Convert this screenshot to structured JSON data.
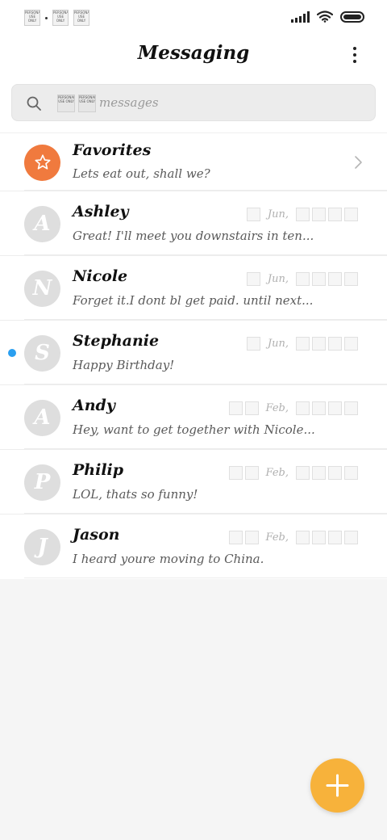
{
  "header": {
    "title": "Messaging"
  },
  "search": {
    "placeholder": "messages",
    "search_icon": "search-icon"
  },
  "status": {
    "watermark": "PERSONAL USE ONLY"
  },
  "conversations": [
    {
      "name": "Favorites",
      "snippet": "Lets eat out, shall we?",
      "initial": "☆",
      "month": "",
      "unread": false,
      "favorite": true
    },
    {
      "name": "Ashley",
      "snippet": "Great! I'll meet you downstairs in ten...",
      "initial": "A",
      "month": "Jun,",
      "unread": false
    },
    {
      "name": "Nicole",
      "snippet": "Forget it.I dont bl get paid. until next...",
      "initial": "N",
      "month": "Jun,",
      "unread": false
    },
    {
      "name": "Stephanie",
      "snippet": "Happy Birthday!",
      "initial": "S",
      "month": "Jun,",
      "unread": true
    },
    {
      "name": "Andy",
      "snippet": "Hey, want to get together with Nicole...",
      "initial": "A",
      "month": "Feb,",
      "unread": false
    },
    {
      "name": "Philip",
      "snippet": "LOL, thats so funny!",
      "initial": "P",
      "month": "Feb,",
      "unread": false
    },
    {
      "name": "Jason",
      "snippet": "I heard youre moving to China.",
      "initial": "J",
      "month": "Feb,",
      "unread": false
    }
  ],
  "colors": {
    "favorite_avatar": "#f07a3e",
    "unread_dot": "#2a9ff0",
    "fab": "#f7b23b",
    "avatar_gray": "#dedede"
  },
  "fab": {
    "icon": "plus-icon"
  }
}
